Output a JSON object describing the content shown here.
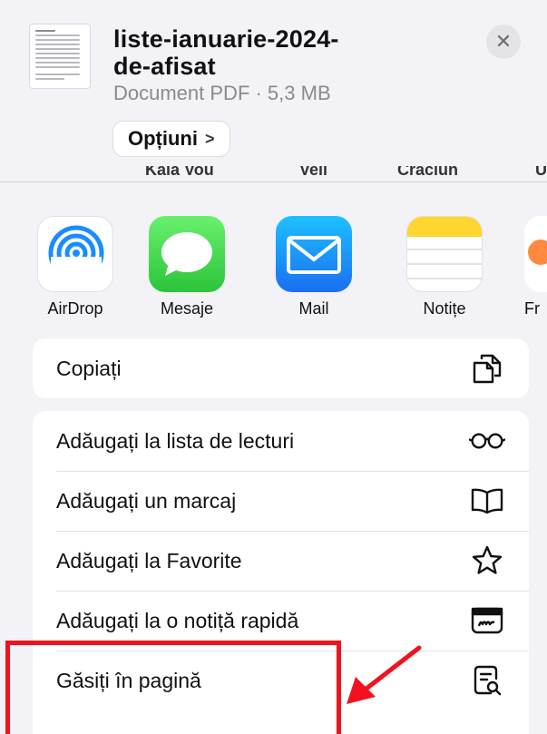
{
  "file": {
    "name": "liste-ianuarie-2024-de-afisat",
    "name_line1": "liste-ianuarie-2024-",
    "name_line2": "de-afisat",
    "meta": "Document PDF · 5,3 MB"
  },
  "header": {
    "options_label": "Opțiuni",
    "options_chevron": ">",
    "close_symbol": "✕"
  },
  "contacts": {
    "names": [
      "Kaia Vou",
      "Veli",
      "Craciun",
      "U"
    ]
  },
  "apps": [
    {
      "label": "AirDrop",
      "icon": "airdrop-icon"
    },
    {
      "label": "Mesaje",
      "icon": "messages-icon"
    },
    {
      "label": "Mail",
      "icon": "mail-icon"
    },
    {
      "label": "Notițe",
      "icon": "notes-icon"
    },
    {
      "label": "Fr",
      "icon": "freeform-icon"
    }
  ],
  "actions_group1": [
    {
      "label": "Copiați",
      "icon": "copy-icon"
    }
  ],
  "actions_group2": [
    {
      "label": "Adăugați la lista de lecturi",
      "icon": "glasses-icon"
    },
    {
      "label": "Adăugați un marcaj",
      "icon": "book-icon"
    },
    {
      "label": "Adăugați la Favorite",
      "icon": "star-icon"
    },
    {
      "label": "Adăugați la o notiță rapidă",
      "icon": "quick-note-icon"
    },
    {
      "label": "Găsiți în pagină",
      "icon": "find-in-page-icon"
    }
  ],
  "annotation": {
    "color": "#f2121e"
  }
}
